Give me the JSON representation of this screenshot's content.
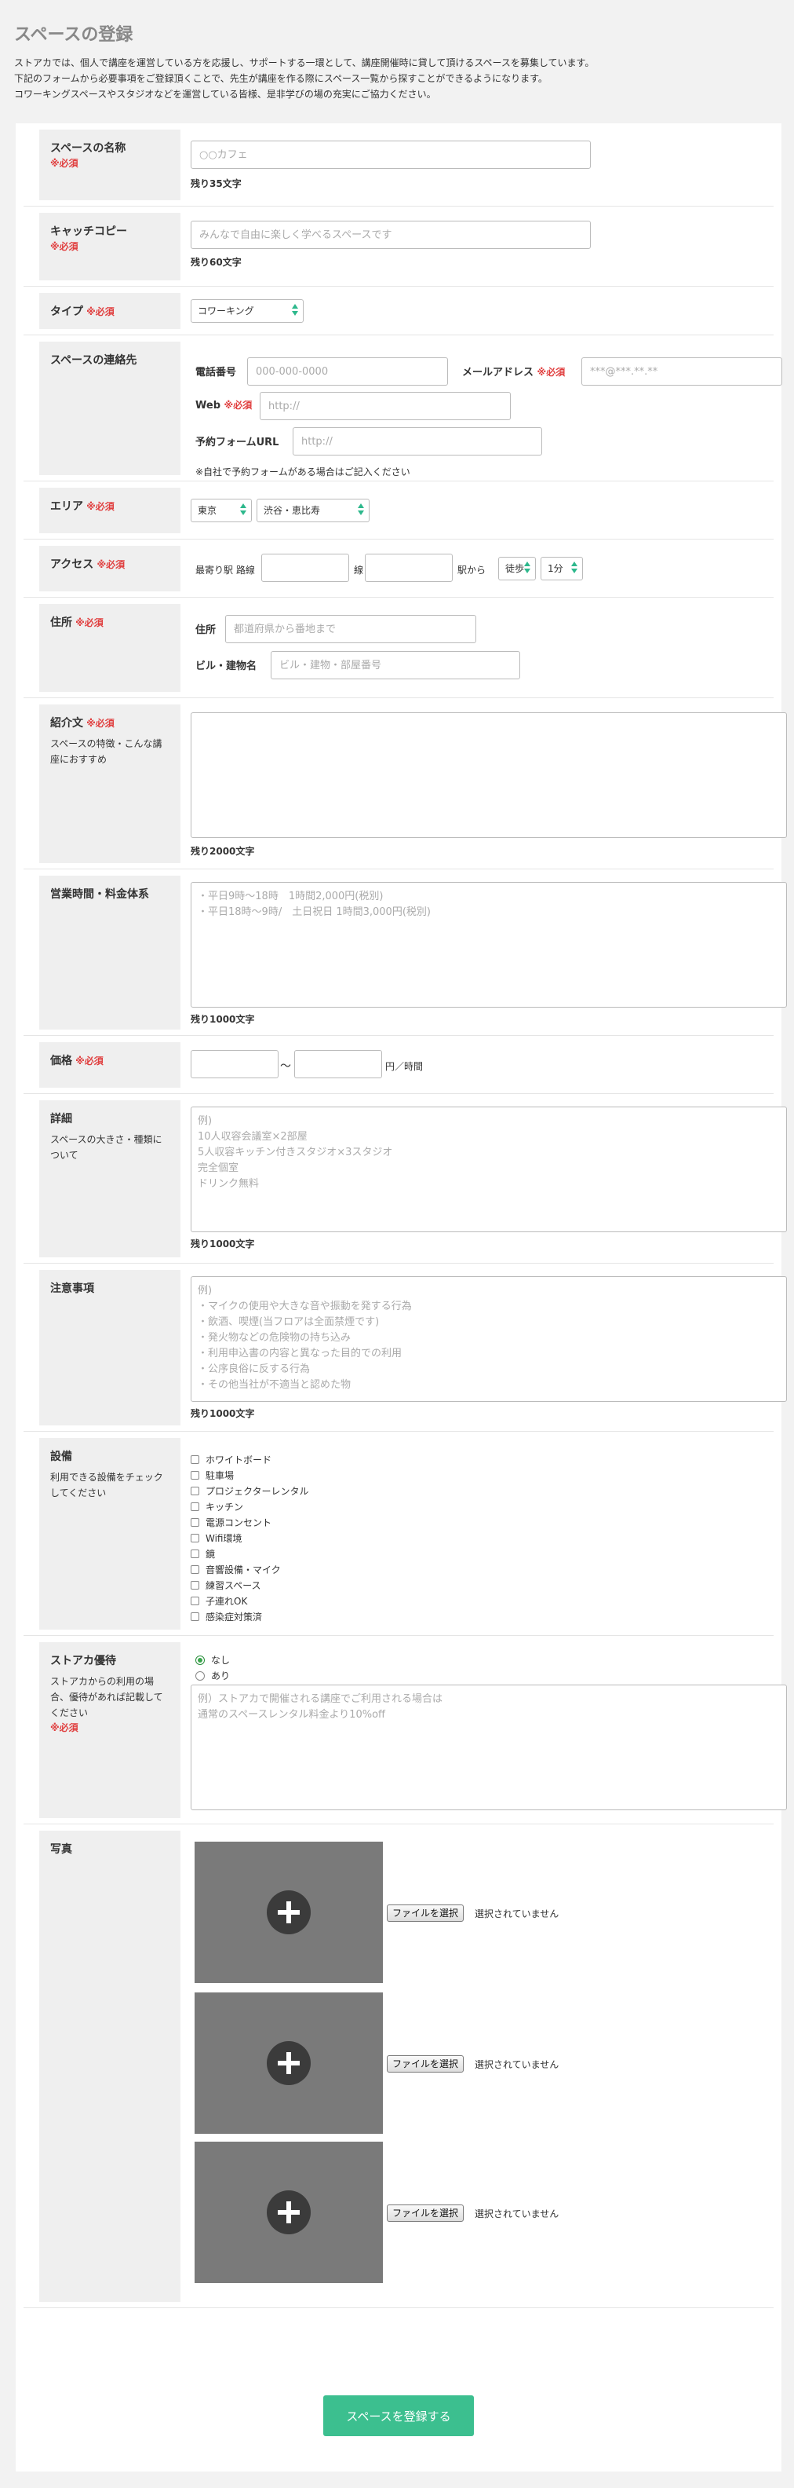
{
  "page": {
    "title": "スペースの登録",
    "intro": [
      "ストアカでは、個人で講座を運営している方を応援し、サポートする一環として、講座開催時に貸して頂けるスペースを募集しています。",
      "下記のフォームから必要事項をご登録頂くことで、先生が講座を作る際にスペース一覧から探すことができるようになります。",
      "コワーキングスペースやスタジオなどを運営している皆様、是非学びの場の充実にご協力ください。"
    ]
  },
  "required_mark": "※必須",
  "name": {
    "label": "スペースの名称",
    "placeholder": "○○カフェ",
    "remaining": "残り35文字"
  },
  "catch": {
    "label": "キャッチコピー",
    "placeholder": "みんなで自由に楽しく学べるスペースです",
    "remaining": "残り60文字"
  },
  "type": {
    "label": "タイプ",
    "selected": "コワーキング"
  },
  "contact": {
    "label": "スペースの連絡先",
    "phone_label": "電話番号",
    "phone_placeholder": "000-000-0000",
    "email_label": "メールアドレス",
    "email_placeholder": "***@***.**.**",
    "web_label": "Web",
    "web_placeholder": "http://",
    "form_label": "予約フォームURL",
    "form_placeholder": "http://",
    "note": "※自社で予約フォームがある場合はご記入ください"
  },
  "area": {
    "label": "エリア",
    "pref": "東京",
    "district": "渋谷・恵比寿"
  },
  "access": {
    "label": "アクセス",
    "prefix": "最寄り駅 路線",
    "line_suffix": "線",
    "station_suffix": "駅から",
    "mode": "徒歩",
    "minutes": "1分"
  },
  "address": {
    "label": "住所",
    "addr_label": "住所",
    "addr_placeholder": "都道府県から番地まで",
    "bldg_label": "ビル・建物名",
    "bldg_placeholder": "ビル・建物・部屋番号"
  },
  "intro_text": {
    "label": "紹介文",
    "desc": "スペースの特徴・こんな講座におすすめ",
    "remaining": "残り2000文字"
  },
  "hours": {
    "label": "営業時間・料金体系",
    "placeholder": "・平日9時〜18時　1時間2,000円(税別)\n・平日18時〜9時/　土日祝日 1時間3,000円(税別)",
    "remaining": "残り1000文字"
  },
  "price": {
    "label": "価格",
    "tilde": "〜",
    "unit": "円／時間"
  },
  "details": {
    "label": "詳細",
    "desc": "スペースの大きさ・種類について",
    "placeholder": "例)\n10人収容会議室×2部屋\n5人収容キッチン付きスタジオ×3スタジオ\n完全個室\nドリンク無料",
    "remaining": "残り1000文字"
  },
  "notes": {
    "label": "注意事項",
    "placeholder": "例)\n・マイクの使用や大きな音や振動を発する行為\n・飲酒、喫煙(当フロアは全面禁煙です)\n・発火物などの危険物の持ち込み\n・利用申込書の内容と異なった目的での利用\n・公序良俗に反する行為\n・その他当社が不適当と認めた物",
    "remaining": "残り1000文字"
  },
  "equipment": {
    "label": "設備",
    "desc": "利用できる設備をチェックしてください",
    "items": [
      "ホワイトボード",
      "駐車場",
      "プロジェクターレンタル",
      "キッチン",
      "電源コンセント",
      "Wifi環境",
      "鏡",
      "音響設備・マイク",
      "練習スペース",
      "子連れOK",
      "感染症対策済"
    ]
  },
  "benefit": {
    "label": "ストアカ優待",
    "desc": "ストアカからの利用の場合、優待があれば記載してください",
    "options": [
      "なし",
      "あり"
    ],
    "selected_index": 0,
    "placeholder": "例）ストアカで開催される講座でご利用される場合は\n通常のスペースレンタル料金より10%off"
  },
  "photos": {
    "label": "写真",
    "button": "ファイルを選択",
    "status": "選択されていません"
  },
  "submit_label": "スペースを登録する",
  "colors": {
    "accent": "#3cbf8f",
    "required": "#e03e3e",
    "label_bg": "#efefef",
    "photo_bg": "#7a7a7a"
  }
}
